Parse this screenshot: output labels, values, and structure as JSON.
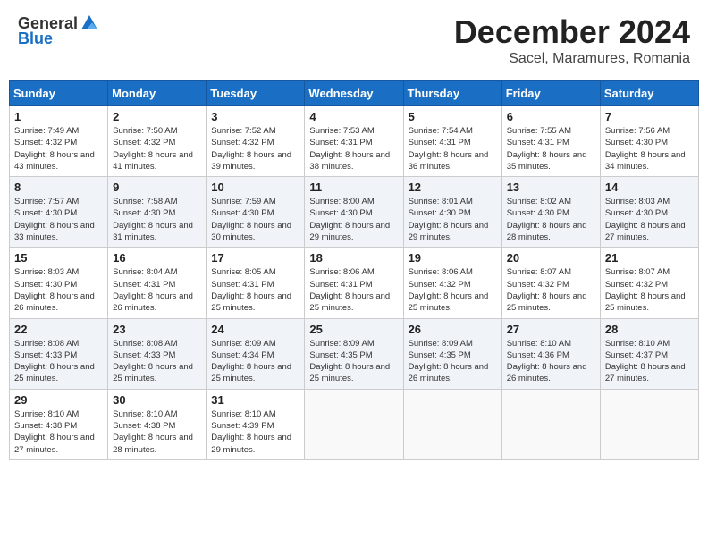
{
  "header": {
    "logo_general": "General",
    "logo_blue": "Blue",
    "month_title": "December 2024",
    "location": "Sacel, Maramures, Romania"
  },
  "weekdays": [
    "Sunday",
    "Monday",
    "Tuesday",
    "Wednesday",
    "Thursday",
    "Friday",
    "Saturday"
  ],
  "weeks": [
    [
      {
        "day": "1",
        "sunrise": "Sunrise: 7:49 AM",
        "sunset": "Sunset: 4:32 PM",
        "daylight": "Daylight: 8 hours and 43 minutes."
      },
      {
        "day": "2",
        "sunrise": "Sunrise: 7:50 AM",
        "sunset": "Sunset: 4:32 PM",
        "daylight": "Daylight: 8 hours and 41 minutes."
      },
      {
        "day": "3",
        "sunrise": "Sunrise: 7:52 AM",
        "sunset": "Sunset: 4:32 PM",
        "daylight": "Daylight: 8 hours and 39 minutes."
      },
      {
        "day": "4",
        "sunrise": "Sunrise: 7:53 AM",
        "sunset": "Sunset: 4:31 PM",
        "daylight": "Daylight: 8 hours and 38 minutes."
      },
      {
        "day": "5",
        "sunrise": "Sunrise: 7:54 AM",
        "sunset": "Sunset: 4:31 PM",
        "daylight": "Daylight: 8 hours and 36 minutes."
      },
      {
        "day": "6",
        "sunrise": "Sunrise: 7:55 AM",
        "sunset": "Sunset: 4:31 PM",
        "daylight": "Daylight: 8 hours and 35 minutes."
      },
      {
        "day": "7",
        "sunrise": "Sunrise: 7:56 AM",
        "sunset": "Sunset: 4:30 PM",
        "daylight": "Daylight: 8 hours and 34 minutes."
      }
    ],
    [
      {
        "day": "8",
        "sunrise": "Sunrise: 7:57 AM",
        "sunset": "Sunset: 4:30 PM",
        "daylight": "Daylight: 8 hours and 33 minutes."
      },
      {
        "day": "9",
        "sunrise": "Sunrise: 7:58 AM",
        "sunset": "Sunset: 4:30 PM",
        "daylight": "Daylight: 8 hours and 31 minutes."
      },
      {
        "day": "10",
        "sunrise": "Sunrise: 7:59 AM",
        "sunset": "Sunset: 4:30 PM",
        "daylight": "Daylight: 8 hours and 30 minutes."
      },
      {
        "day": "11",
        "sunrise": "Sunrise: 8:00 AM",
        "sunset": "Sunset: 4:30 PM",
        "daylight": "Daylight: 8 hours and 29 minutes."
      },
      {
        "day": "12",
        "sunrise": "Sunrise: 8:01 AM",
        "sunset": "Sunset: 4:30 PM",
        "daylight": "Daylight: 8 hours and 29 minutes."
      },
      {
        "day": "13",
        "sunrise": "Sunrise: 8:02 AM",
        "sunset": "Sunset: 4:30 PM",
        "daylight": "Daylight: 8 hours and 28 minutes."
      },
      {
        "day": "14",
        "sunrise": "Sunrise: 8:03 AM",
        "sunset": "Sunset: 4:30 PM",
        "daylight": "Daylight: 8 hours and 27 minutes."
      }
    ],
    [
      {
        "day": "15",
        "sunrise": "Sunrise: 8:03 AM",
        "sunset": "Sunset: 4:30 PM",
        "daylight": "Daylight: 8 hours and 26 minutes."
      },
      {
        "day": "16",
        "sunrise": "Sunrise: 8:04 AM",
        "sunset": "Sunset: 4:31 PM",
        "daylight": "Daylight: 8 hours and 26 minutes."
      },
      {
        "day": "17",
        "sunrise": "Sunrise: 8:05 AM",
        "sunset": "Sunset: 4:31 PM",
        "daylight": "Daylight: 8 hours and 25 minutes."
      },
      {
        "day": "18",
        "sunrise": "Sunrise: 8:06 AM",
        "sunset": "Sunset: 4:31 PM",
        "daylight": "Daylight: 8 hours and 25 minutes."
      },
      {
        "day": "19",
        "sunrise": "Sunrise: 8:06 AM",
        "sunset": "Sunset: 4:32 PM",
        "daylight": "Daylight: 8 hours and 25 minutes."
      },
      {
        "day": "20",
        "sunrise": "Sunrise: 8:07 AM",
        "sunset": "Sunset: 4:32 PM",
        "daylight": "Daylight: 8 hours and 25 minutes."
      },
      {
        "day": "21",
        "sunrise": "Sunrise: 8:07 AM",
        "sunset": "Sunset: 4:32 PM",
        "daylight": "Daylight: 8 hours and 25 minutes."
      }
    ],
    [
      {
        "day": "22",
        "sunrise": "Sunrise: 8:08 AM",
        "sunset": "Sunset: 4:33 PM",
        "daylight": "Daylight: 8 hours and 25 minutes."
      },
      {
        "day": "23",
        "sunrise": "Sunrise: 8:08 AM",
        "sunset": "Sunset: 4:33 PM",
        "daylight": "Daylight: 8 hours and 25 minutes."
      },
      {
        "day": "24",
        "sunrise": "Sunrise: 8:09 AM",
        "sunset": "Sunset: 4:34 PM",
        "daylight": "Daylight: 8 hours and 25 minutes."
      },
      {
        "day": "25",
        "sunrise": "Sunrise: 8:09 AM",
        "sunset": "Sunset: 4:35 PM",
        "daylight": "Daylight: 8 hours and 25 minutes."
      },
      {
        "day": "26",
        "sunrise": "Sunrise: 8:09 AM",
        "sunset": "Sunset: 4:35 PM",
        "daylight": "Daylight: 8 hours and 26 minutes."
      },
      {
        "day": "27",
        "sunrise": "Sunrise: 8:10 AM",
        "sunset": "Sunset: 4:36 PM",
        "daylight": "Daylight: 8 hours and 26 minutes."
      },
      {
        "day": "28",
        "sunrise": "Sunrise: 8:10 AM",
        "sunset": "Sunset: 4:37 PM",
        "daylight": "Daylight: 8 hours and 27 minutes."
      }
    ],
    [
      {
        "day": "29",
        "sunrise": "Sunrise: 8:10 AM",
        "sunset": "Sunset: 4:38 PM",
        "daylight": "Daylight: 8 hours and 27 minutes."
      },
      {
        "day": "30",
        "sunrise": "Sunrise: 8:10 AM",
        "sunset": "Sunset: 4:38 PM",
        "daylight": "Daylight: 8 hours and 28 minutes."
      },
      {
        "day": "31",
        "sunrise": "Sunrise: 8:10 AM",
        "sunset": "Sunset: 4:39 PM",
        "daylight": "Daylight: 8 hours and 29 minutes."
      },
      null,
      null,
      null,
      null
    ]
  ]
}
